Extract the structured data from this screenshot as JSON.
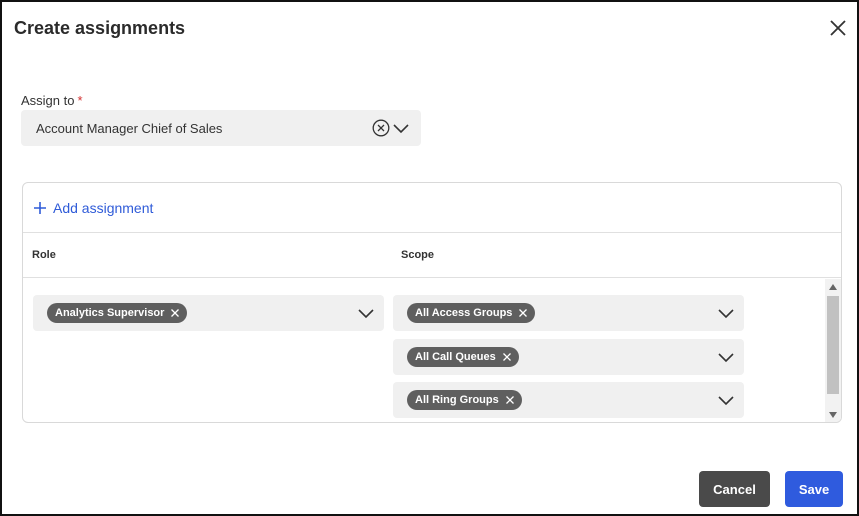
{
  "dialog": {
    "title": "Create assignments"
  },
  "assign_to": {
    "label": "Assign to",
    "required_marker": "*",
    "value": "Account Manager Chief of Sales"
  },
  "assignments": {
    "add_label": "Add assignment",
    "columns": {
      "role": "Role",
      "scope": "Scope"
    },
    "role_chip": "Analytics Supervisor",
    "scope_chips": [
      "All Access Groups",
      "All Call Queues",
      "All Ring Groups"
    ]
  },
  "footer": {
    "cancel_label": "Cancel",
    "save_label": "Save"
  },
  "colors": {
    "accent": "#2f5bde",
    "chip": "#5f5f5f",
    "cancel": "#4a4a4a",
    "required": "#d32f2f"
  },
  "icons": {
    "close": "close-icon",
    "clear": "clear-circle-icon",
    "dropdown": "chevron-down-icon",
    "add": "plus-icon",
    "chip_remove": "chip-remove-icon"
  }
}
